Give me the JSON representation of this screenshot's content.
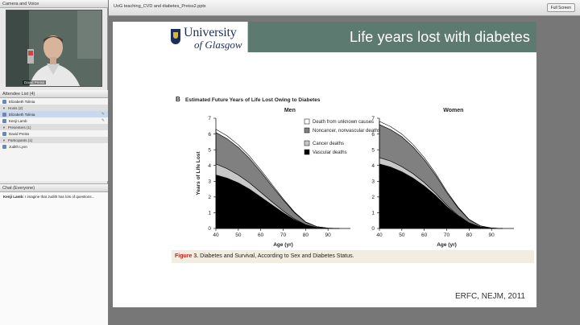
{
  "camera": {
    "title": "Camera and Voice",
    "presenter_name": "David Preiss"
  },
  "attendees": {
    "title": "Attendee List",
    "count": "(4)",
    "top_user": "Elizabeth Tolinia",
    "groups": [
      {
        "label": "Hosts (2)",
        "members": [
          "Elizabeth Tolinia",
          "Kenji Lamb"
        ]
      },
      {
        "label": "Presenters (1)",
        "members": [
          "David Preiss"
        ]
      },
      {
        "label": "Participants (1)",
        "members": [
          "Judith Lyon"
        ]
      }
    ]
  },
  "chat": {
    "title": "Chat",
    "scope": "(Everyone)",
    "sender": "Kenji Lamb:",
    "message": "I imagine that Judith has lots of questions..."
  },
  "document": {
    "name": "UoG teaching_CVD and diabetes_Preiss2.pptx",
    "full_screen_label": "Full Screen"
  },
  "slide": {
    "logo_line1": "University",
    "logo_line2": "of Glasgow",
    "title": "Life years lost with diabetes",
    "reference": "ERFC, NEJM, 2011"
  },
  "figure": {
    "panel_letter": "B",
    "heading": "Estimated Future Years of Life Lost Owing to Diabetes",
    "caption_label": "Figure 3.",
    "caption_text": "Diabetes and Survival, According to Sex and Diabetes Status.",
    "colors": {
      "unknown": "#ffffff",
      "noncancer": "#808080",
      "cancer": "#c8c8c8",
      "vascular": "#000000"
    }
  },
  "chart_data": [
    {
      "type": "area",
      "title": "Men",
      "xlabel": "Age (yr)",
      "ylabel": "Years of Life Lost",
      "xlim": [
        40,
        100
      ],
      "ylim": [
        0,
        7
      ],
      "x_ticks": [
        40,
        50,
        60,
        70,
        80,
        90
      ],
      "y_ticks": [
        0,
        1,
        2,
        3,
        4,
        5,
        6,
        7
      ],
      "stacked": true,
      "legend_position": "top-right",
      "x": [
        40,
        45,
        50,
        55,
        60,
        65,
        70,
        75,
        80,
        85,
        90,
        95
      ],
      "series": [
        {
          "name": "Vascular deaths",
          "values": [
            3.4,
            3.2,
            2.9,
            2.5,
            2.0,
            1.5,
            1.0,
            0.55,
            0.22,
            0.06,
            0.01,
            0.0
          ]
        },
        {
          "name": "Cancer deaths",
          "values": [
            0.7,
            0.6,
            0.5,
            0.4,
            0.3,
            0.2,
            0.12,
            0.06,
            0.02,
            0.0,
            0.0,
            0.0
          ]
        },
        {
          "name": "Noncancer, nonvascular deaths",
          "values": [
            2.0,
            1.9,
            1.75,
            1.55,
            1.3,
            1.0,
            0.7,
            0.4,
            0.16,
            0.05,
            0.01,
            0.0
          ]
        },
        {
          "name": "Death from unknown causes",
          "values": [
            0.2,
            0.18,
            0.16,
            0.14,
            0.12,
            0.1,
            0.07,
            0.04,
            0.02,
            0.01,
            0.0,
            0.0
          ]
        }
      ]
    },
    {
      "type": "area",
      "title": "Women",
      "xlabel": "Age (yr)",
      "ylabel": "",
      "xlim": [
        40,
        100
      ],
      "ylim": [
        0,
        7
      ],
      "x_ticks": [
        40,
        50,
        60,
        70,
        80,
        90
      ],
      "y_ticks": [
        0,
        1,
        2,
        3,
        4,
        5,
        6,
        7
      ],
      "stacked": true,
      "x": [
        40,
        45,
        50,
        55,
        60,
        65,
        70,
        75,
        80,
        85,
        90,
        95
      ],
      "series": [
        {
          "name": "Vascular deaths",
          "values": [
            4.1,
            3.9,
            3.6,
            3.2,
            2.7,
            2.1,
            1.4,
            0.8,
            0.35,
            0.1,
            0.02,
            0.0
          ]
        },
        {
          "name": "Cancer deaths",
          "values": [
            0.4,
            0.38,
            0.33,
            0.28,
            0.22,
            0.15,
            0.09,
            0.04,
            0.01,
            0.0,
            0.0,
            0.0
          ]
        },
        {
          "name": "Noncancer, nonvascular deaths",
          "values": [
            2.1,
            2.0,
            1.9,
            1.7,
            1.45,
            1.15,
            0.8,
            0.48,
            0.2,
            0.06,
            0.01,
            0.0
          ]
        },
        {
          "name": "Death from unknown causes",
          "values": [
            0.2,
            0.19,
            0.17,
            0.15,
            0.13,
            0.11,
            0.08,
            0.05,
            0.02,
            0.01,
            0.0,
            0.0
          ]
        }
      ]
    }
  ]
}
